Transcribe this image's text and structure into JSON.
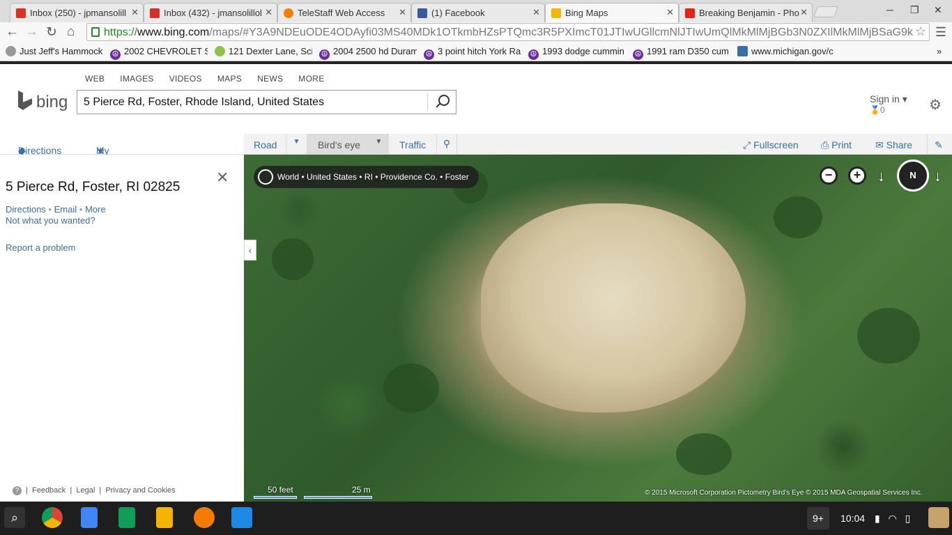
{
  "browser": {
    "tabs": [
      {
        "title": "Inbox (250) - jpmansolill",
        "fav_color": "#d93025"
      },
      {
        "title": "Inbox (432) - jmansolillol",
        "fav_color": "#d93025"
      },
      {
        "title": "TeleStaff Web Access",
        "fav_color": "#f57c00"
      },
      {
        "title": "(1) Facebook",
        "fav_color": "#3b5998"
      },
      {
        "title": "Bing Maps",
        "fav_color": "#f5b800"
      },
      {
        "title": "Breaking Benjamin - Pho",
        "fav_color": "#e62117"
      }
    ],
    "url_https": "https://",
    "url_host": "www.bing.com",
    "url_path": "/maps/#Y3A9NDEuODE4ODAyfi03MS40MDk1OTkmbHZsPTQmc3R5PXImcT01JTIwUGllcmNlJTIwUmQlMkMlMjBGb3N0ZXIlMkMlMjBSaG9k",
    "bookmarks": [
      "Just Jeff's Hammock",
      "2002 CHEVROLET SI",
      "121 Dexter Lane, Sci",
      "2004 2500 hd Duram",
      "3 point hitch York Ra",
      "1993 dodge cummin",
      "1991 ram D350 cum",
      "www.michigan.gov/c"
    ],
    "bookmark_more": "»"
  },
  "bing": {
    "nav": [
      "WEB",
      "IMAGES",
      "VIDEOS",
      "MAPS",
      "NEWS",
      "MORE"
    ],
    "logo": "bing",
    "search_value": "5 Pierce Rd, Foster, Rhode Island, United States",
    "signin": "Sign in ▾",
    "rewards": "0"
  },
  "left_nav": {
    "directions": "Directions",
    "my_places": "My places"
  },
  "map_bar": {
    "road": "Road",
    "birds_eye": "Bird's eye",
    "traffic": "Traffic",
    "fullscreen": "Fullscreen",
    "print": "Print",
    "share": "Share"
  },
  "panel": {
    "title": "5 Pierce Rd, Foster, RI 02825",
    "directions": "Directions",
    "email": "Email",
    "more": "More",
    "not_wanted": "Not what you wanted?",
    "report": "Report a problem",
    "footer": [
      "Feedback",
      "Legal",
      "Privacy and Cookies"
    ]
  },
  "map": {
    "breadcrumb": "World • United States • RI • Providence Co. • Foster",
    "compass": "N",
    "scale_feet": "50 feet",
    "scale_m": "25 m",
    "copyright": "© 2015 Microsoft Corporation     Pictometry Bird's Eye © 2015 MDA Geospatial Services Inc."
  },
  "shelf": {
    "badge": "9+",
    "time": "10:04"
  }
}
